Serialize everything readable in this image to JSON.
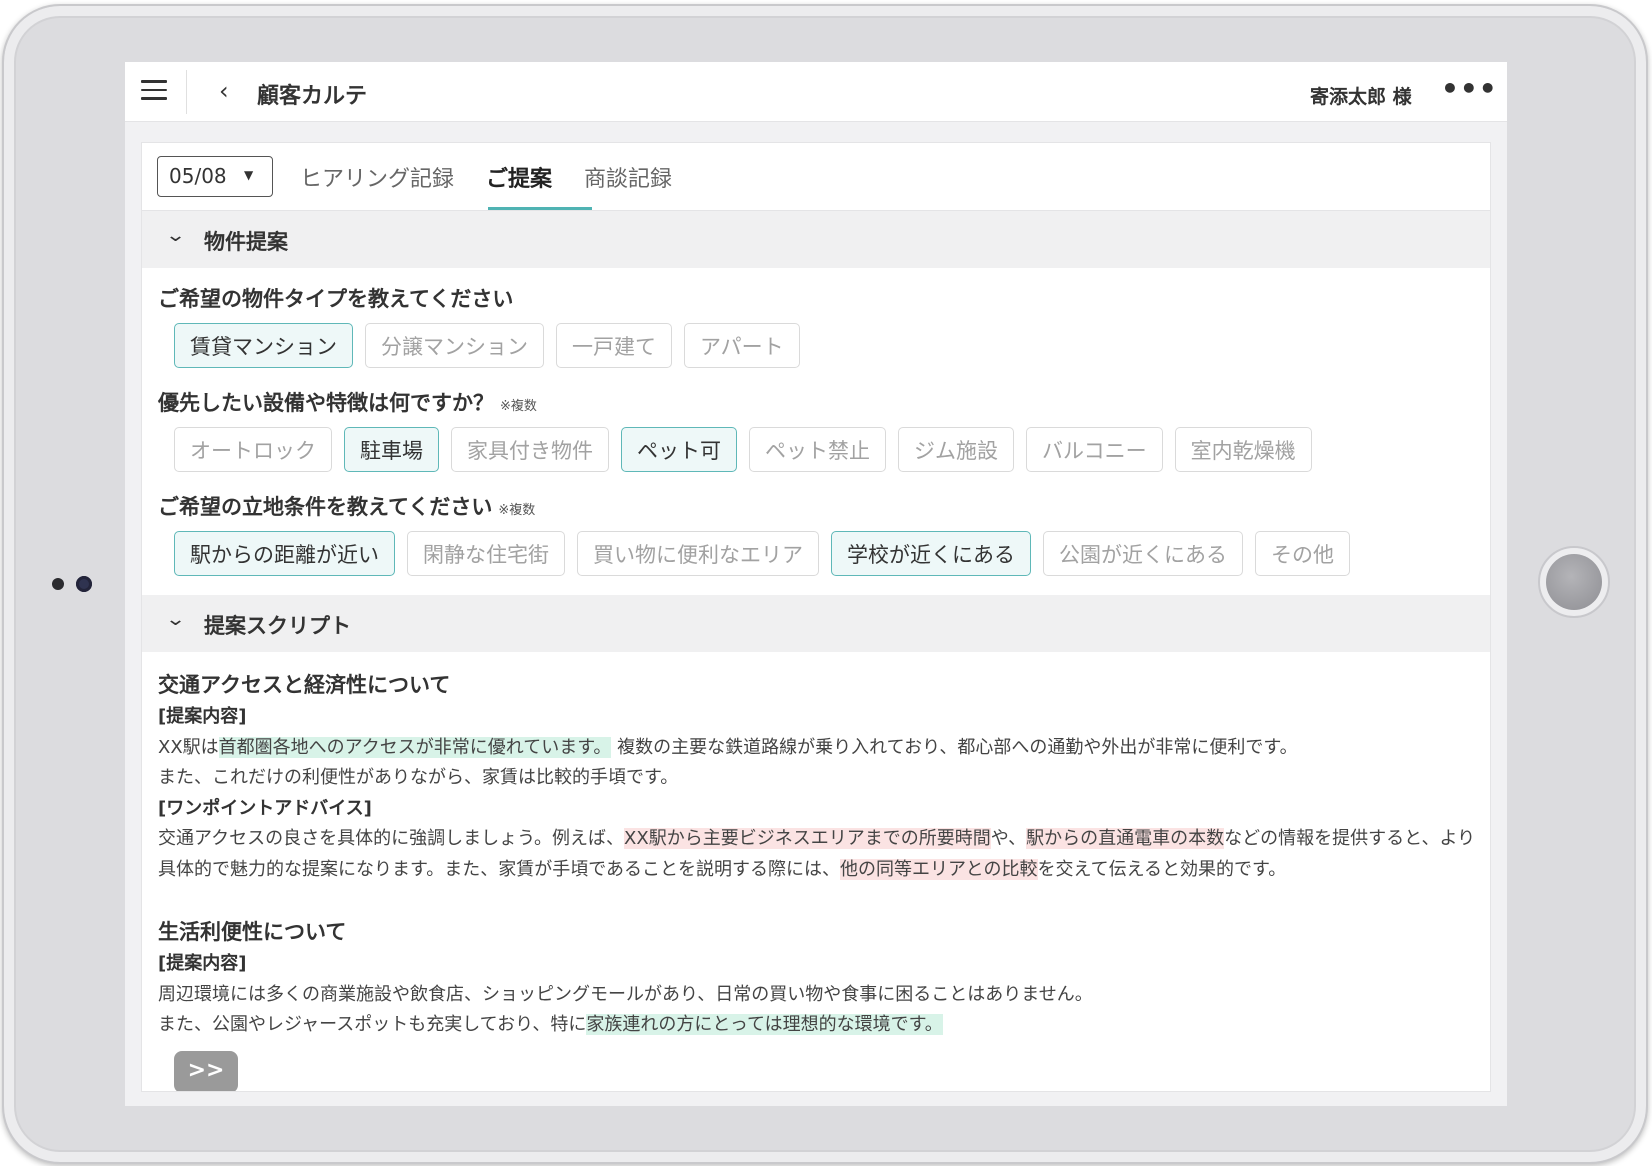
{
  "header": {
    "title": "顧客カルテ",
    "customer": "寄添太郎 様",
    "more": "•••"
  },
  "tabs": {
    "date": "05/08",
    "items": [
      "ヒアリング記録",
      "ご提案",
      "商談記録"
    ],
    "active": "ご提案"
  },
  "property_section": {
    "title": "物件提案",
    "q1": {
      "label": "ご希望の物件タイプを教えてください",
      "options": [
        "賃貸マンション",
        "分譲マンション",
        "一戸建て",
        "アパート"
      ],
      "selected": [
        "賃貸マンション"
      ]
    },
    "q2": {
      "label": "優先したい設備や特徴は何ですか？",
      "note": "※複数",
      "options": [
        "オートロック",
        "駐車場",
        "家具付き物件",
        "ペット可",
        "ペット禁止",
        "ジム施設",
        "バルコニー",
        "室内乾燥機"
      ],
      "selected": [
        "駐車場",
        "ペット可"
      ]
    },
    "q3": {
      "label": "ご希望の立地条件を教えてください",
      "note": "※複数",
      "options": [
        "駅からの距離が近い",
        "閑静な住宅街",
        "買い物に便利なエリア",
        "学校が近くにある",
        "公園が近くにある",
        "その他"
      ],
      "selected": [
        "駅からの距離が近い",
        "学校が近くにある"
      ]
    }
  },
  "script_section": {
    "title": "提案スクリプト",
    "block1": {
      "heading": "交通アクセスと経済性について",
      "label1": "[提案内容]",
      "p1a": "XX駅は",
      "p1b": "首都圏各地へのアクセスが非常に優れています。",
      "p1c": "複数の主要な鉄道路線が乗り入れており、都心部への通勤や外出が非常に便利です。",
      "p1d": "また、これだけの利便性がありながら、家賃は比較的手頃です。",
      "label2": "[ワンポイントアドバイス]",
      "a1": "交通アクセスの良さを具体的に強調しましょう。例えば、",
      "a2": "XX駅から主要ビジネスエリアまでの所要時間",
      "a3": "や、",
      "a4": "駅からの直通電車の本数",
      "a5": "などの情報を提供すると、より具体的で魅力的な提案になります。また、家賃が手頃であることを説明する際には、",
      "a6": "他の同等エリアとの比較",
      "a7": "を交えて伝えると効果的です。"
    },
    "block2": {
      "heading": "生活利便性について",
      "label1": "[提案内容]",
      "p1": "周辺環境には多くの商業施設や飲食店、ショッピングモールがあり、日常の買い物や食事に困ることはありません。",
      "p2a": "また、公園やレジャースポットも充実しており、特に",
      "p2b": "家族連れの方にとっては理想的な環境です。"
    }
  },
  "float_button": ">>"
}
